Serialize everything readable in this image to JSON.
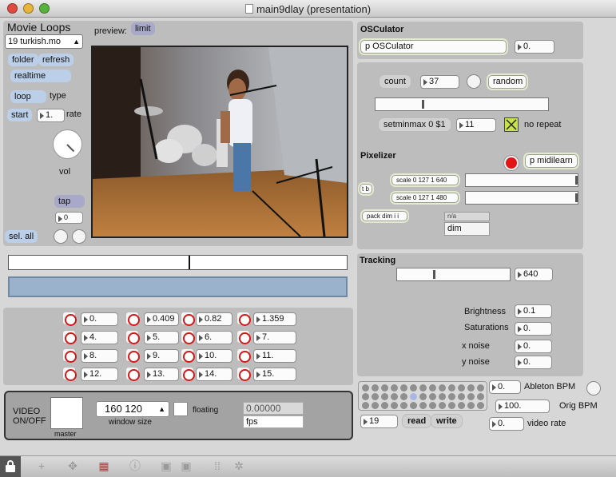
{
  "window": {
    "title": "main9dlay (presentation)"
  },
  "movie": {
    "title": "Movie Loops",
    "file": "19 turkish.mo",
    "folder": "folder",
    "refresh": "refresh",
    "realtime": "realtime",
    "loop": "loop",
    "type": "type",
    "start": "start",
    "rate_value": "1.",
    "rate": "rate",
    "vol": "vol",
    "tap": "tap",
    "tap_value": "0",
    "sel_all": "sel. all"
  },
  "preview": {
    "label": "preview:",
    "limit": "limit"
  },
  "grid": {
    "values": [
      "0.",
      "0.409",
      "0.82",
      "1.359",
      "4.",
      "5.",
      "6.",
      "7.",
      "8.",
      "9.",
      "10.",
      "11.",
      "12.",
      "13.",
      "14.",
      "15."
    ]
  },
  "video": {
    "label_line1": "VIDEO",
    "label_line2": "ON/OFF",
    "master": "master",
    "size": "160 120",
    "size_label": "window size",
    "floating": "floating",
    "fps_value": "0.00000",
    "fps": "fps"
  },
  "osc": {
    "title": "OSCulator",
    "obj": "p OSCulator",
    "value": "0."
  },
  "counter": {
    "count": "count",
    "count_value": "37",
    "random": "random",
    "slider_value": 0.27,
    "setminmax": "setminmax 0 $1",
    "max_value": "11",
    "norepeat": "no repeat"
  },
  "pixelizer": {
    "title": "Pixelizer",
    "midilearn": "p midilearn",
    "scale1": "scale 0 127 1 640",
    "scale2": "scale 0 127 1 480",
    "tb": "t b",
    "pack": "pack dim i i",
    "na": "n/a",
    "dim": "dim",
    "slider1": 1.0,
    "slider2": 1.0
  },
  "tracking": {
    "title": "Tracking",
    "value": "640",
    "slider_value": 0.32,
    "brightness": "Brightness",
    "brightness_value": "0.1",
    "saturations": "Saturations",
    "saturations_value": "0.",
    "xnoise": "x noise",
    "xnoise_value": "0.",
    "ynoise": "y noise",
    "ynoise_value": "0."
  },
  "bpm": {
    "ableton_value": "0.",
    "ableton": "Ableton BPM",
    "orig_value": "100.",
    "orig": "Orig BPM",
    "rate_value": "0.",
    "rate": "video rate",
    "pos_value": "19",
    "read": "read",
    "write": "write"
  },
  "colors": {
    "accent_red": "#d21818",
    "msg_blue": "#bccfe8"
  }
}
